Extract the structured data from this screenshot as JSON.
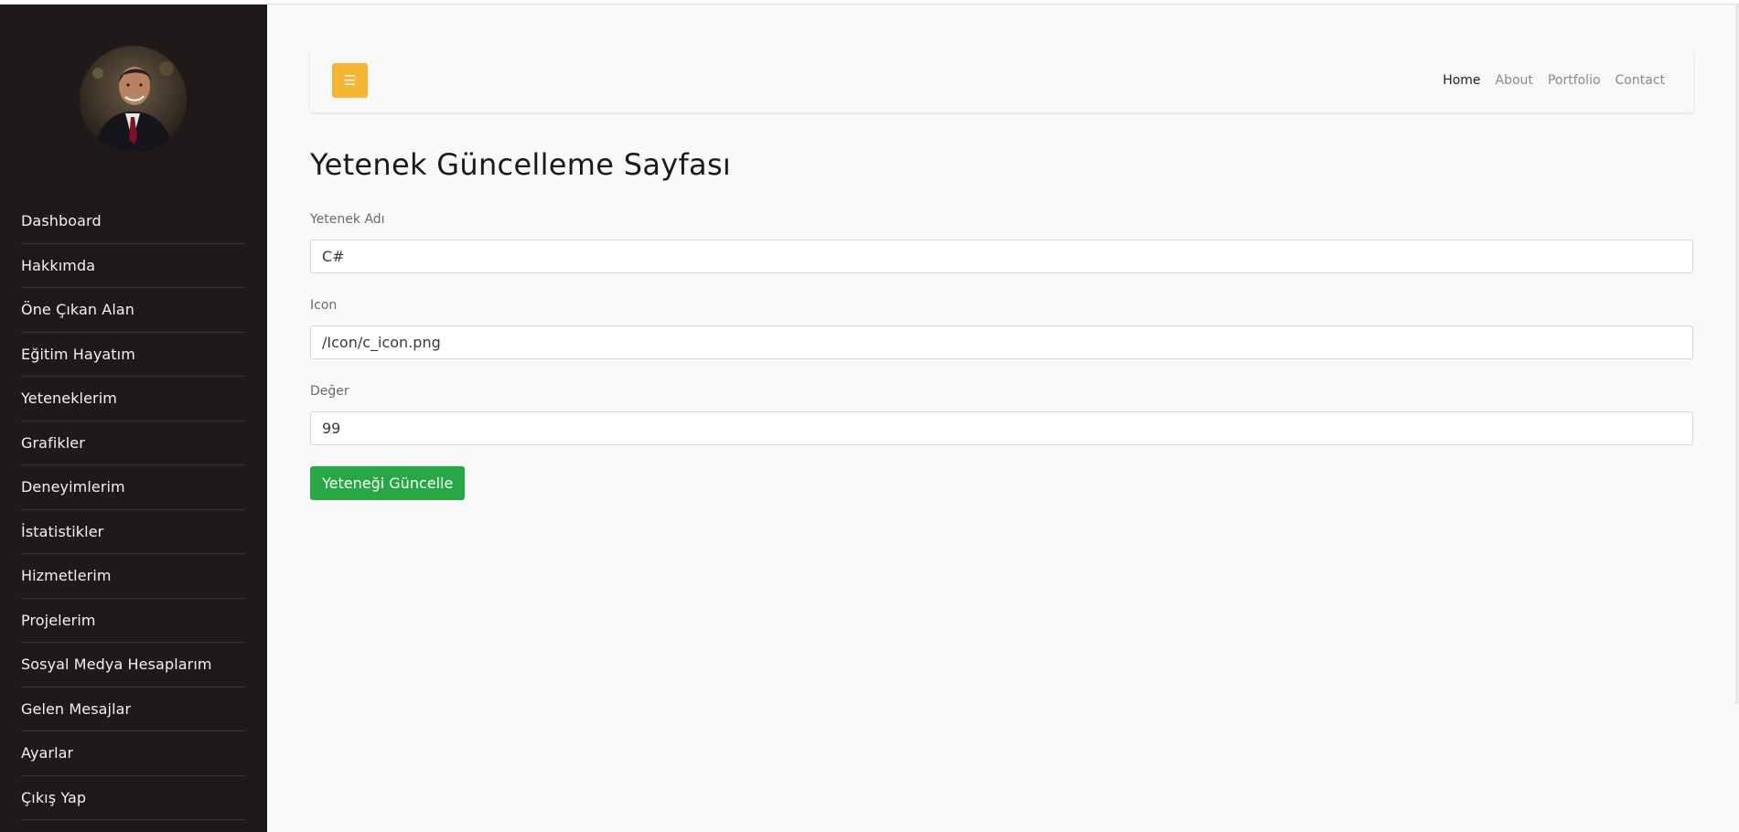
{
  "sidebar": {
    "items": [
      {
        "label": "Dashboard"
      },
      {
        "label": "Hakkımda"
      },
      {
        "label": "Öne Çıkan Alan"
      },
      {
        "label": "Eğitim Hayatım"
      },
      {
        "label": "Yeteneklerim"
      },
      {
        "label": "Grafikler"
      },
      {
        "label": "Deneyimlerim"
      },
      {
        "label": "İstatistikler"
      },
      {
        "label": "Hizmetlerim"
      },
      {
        "label": "Projelerim"
      },
      {
        "label": "Sosyal Medya Hesaplarım"
      },
      {
        "label": "Gelen Mesajlar"
      },
      {
        "label": "Ayarlar"
      },
      {
        "label": "Çıkış Yap"
      }
    ]
  },
  "header": {
    "toggle_icon": "bars-icon",
    "nav": [
      "Home",
      "About",
      "Portfolio",
      "Contact"
    ],
    "active_nav": "Home"
  },
  "page": {
    "title": "Yetenek Güncelleme Sayfası"
  },
  "form": {
    "name_label": "Yetenek Adı",
    "name_value": "C#",
    "icon_label": "Icon",
    "icon_value": "/Icon/c_icon.png",
    "value_label": "Değer",
    "value_value": "99",
    "submit_label": "Yeteneği Güncelle"
  },
  "colors": {
    "sidebar_bg": "#1f1a19",
    "toggle_bg": "#f8b535",
    "submit_bg": "#28a745"
  }
}
